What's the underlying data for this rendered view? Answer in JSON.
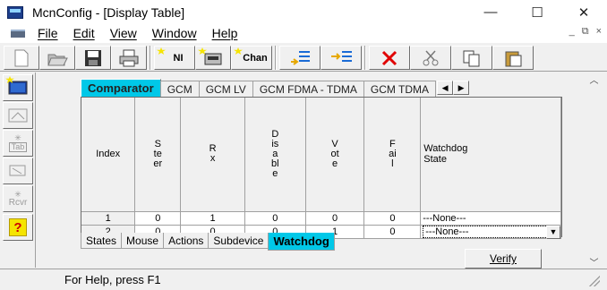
{
  "window": {
    "title": "McnConfig - [Display Table]",
    "controls": [
      "—",
      "☐",
      "✕"
    ]
  },
  "menubar": {
    "items": [
      "File",
      "Edit",
      "View",
      "Window",
      "Help"
    ],
    "mdi_controls": [
      "_",
      "⧉",
      "×"
    ]
  },
  "toolbar": {
    "new_label": "",
    "ni_label": "NI",
    "chan_label": "Chan"
  },
  "sidebar": {
    "tab_label": "Tab",
    "rcvr_label": "Rcvr",
    "help_label": "?"
  },
  "tabs_top": [
    "Comparator",
    "GCM",
    "GCM LV",
    "GCM FDMA - TDMA",
    "GCM TDMA"
  ],
  "table": {
    "headers": [
      "Index",
      "Steer",
      "Rx",
      "Disable",
      "Vote",
      "Fail",
      "Watchdog State"
    ],
    "rows": [
      {
        "index": "1",
        "steer": "0",
        "rx": "1",
        "disable": "0",
        "vote": "0",
        "fail": "0",
        "watchdog": "---None---"
      },
      {
        "index": "2",
        "steer": "0",
        "rx": "0",
        "disable": "0",
        "vote": "1",
        "fail": "0",
        "watchdog": "---None---"
      }
    ]
  },
  "tabs_bottom": [
    "States",
    "Mouse",
    "Actions",
    "Subdevice",
    "Watchdog"
  ],
  "verify_label": "Verify",
  "status": {
    "text": "For Help, press F1"
  },
  "colors": {
    "active_tab": "#00c8e8",
    "delete_icon": "#e00000"
  }
}
